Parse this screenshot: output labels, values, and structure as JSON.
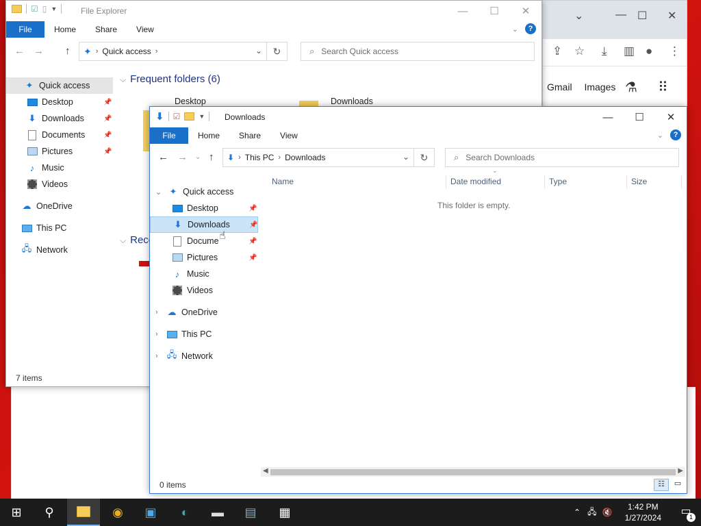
{
  "back_window": {
    "title": "File Explorer",
    "ribbon": {
      "file": "File",
      "tabs": [
        "Home",
        "Share",
        "View"
      ]
    },
    "address": {
      "crumb": "Quick access"
    },
    "search_placeholder": "Search Quick access",
    "nav": [
      {
        "label": "Quick access",
        "icon": "star"
      },
      {
        "label": "Desktop",
        "icon": "desktop",
        "pinned": true
      },
      {
        "label": "Downloads",
        "icon": "download",
        "pinned": true
      },
      {
        "label": "Documents",
        "icon": "document",
        "pinned": true
      },
      {
        "label": "Pictures",
        "icon": "picture",
        "pinned": true
      },
      {
        "label": "Music",
        "icon": "music"
      },
      {
        "label": "Videos",
        "icon": "video"
      },
      {
        "label": "OneDrive",
        "icon": "cloud"
      },
      {
        "label": "This PC",
        "icon": "computer"
      },
      {
        "label": "Network",
        "icon": "network"
      }
    ],
    "frequent_header": "Frequent folders (6)",
    "recent_header": "Rece",
    "tiles": [
      "Desktop",
      "Downloads"
    ],
    "status": "7 items"
  },
  "front_window": {
    "title": "Downloads",
    "ribbon": {
      "file": "File",
      "tabs": [
        "Home",
        "Share",
        "View"
      ]
    },
    "address": {
      "crumbs": [
        "This PC",
        "Downloads"
      ]
    },
    "search_placeholder": "Search Downloads",
    "nav": [
      {
        "label": "Quick access",
        "icon": "star"
      },
      {
        "label": "Desktop",
        "icon": "desktop",
        "pinned": true
      },
      {
        "label": "Downloads",
        "icon": "download",
        "pinned": true,
        "selected": true
      },
      {
        "label": "Docume",
        "icon": "document",
        "pinned": true
      },
      {
        "label": "Pictures",
        "icon": "picture",
        "pinned": true
      },
      {
        "label": "Music",
        "icon": "music"
      },
      {
        "label": "Videos",
        "icon": "video"
      },
      {
        "label": "OneDrive",
        "icon": "cloud"
      },
      {
        "label": "This PC",
        "icon": "computer"
      },
      {
        "label": "Network",
        "icon": "network"
      }
    ],
    "columns": [
      "Name",
      "Date modified",
      "Type",
      "Size"
    ],
    "empty_text": "This folder is empty.",
    "status": "0 items"
  },
  "chrome": {
    "links": [
      "Gmail",
      "Images"
    ]
  },
  "taskbar": {
    "apps": [
      "start",
      "search",
      "file-explorer",
      "chrome",
      "control-panel",
      "edge",
      "drive",
      "notepad",
      "calculator"
    ],
    "time": "1:42 PM",
    "date": "1/27/2024",
    "notifications": "1"
  },
  "colors": {
    "accent": "#1a6fc9",
    "selection": "#cce4f7",
    "taskbar": "#1c1c1c"
  }
}
